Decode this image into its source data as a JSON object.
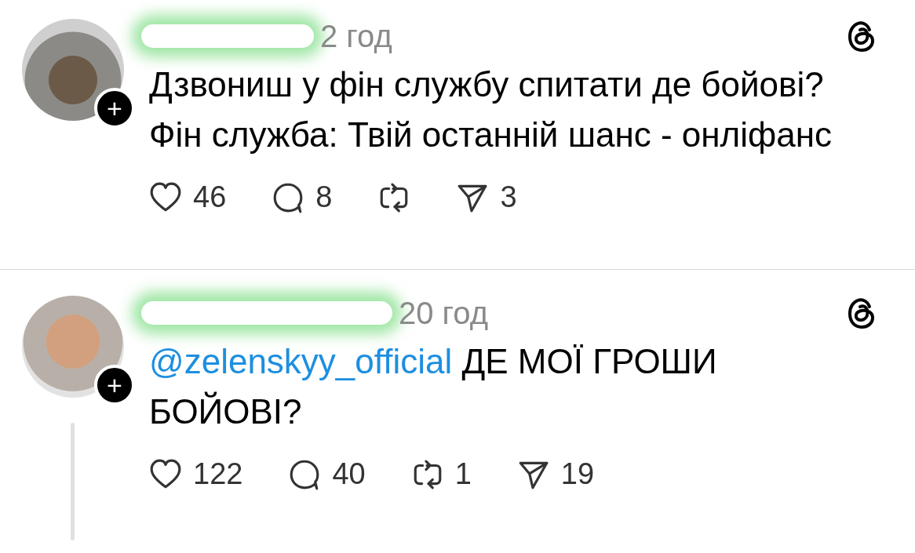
{
  "posts": [
    {
      "time": "2 год",
      "username_redacted": true,
      "follow_badge": "+",
      "thread_line": false,
      "lines": [
        [
          {
            "kind": "text",
            "text": "Дзвониш у фін службу спитати де бойові?"
          }
        ],
        [
          {
            "kind": "text",
            "text": "Фін служба: Твій останній шанс - онліфанс"
          }
        ]
      ],
      "actions": [
        {
          "kind": "like",
          "count": "46"
        },
        {
          "kind": "reply",
          "count": "8"
        },
        {
          "kind": "repost"
        },
        {
          "kind": "share",
          "count": "3"
        }
      ]
    },
    {
      "time": "20 год",
      "username_redacted": true,
      "follow_badge": "+",
      "thread_line": true,
      "lines": [
        [
          {
            "kind": "mention",
            "text": "@zelenskyy_official"
          },
          {
            "kind": "text",
            "text": " ДЕ МОЇ ГРОШИ"
          }
        ],
        [
          {
            "kind": "text",
            "text": "БОЙОВІ?"
          }
        ]
      ],
      "actions": [
        {
          "kind": "like",
          "count": "122"
        },
        {
          "kind": "reply",
          "count": "40"
        },
        {
          "kind": "repost",
          "count": "1"
        },
        {
          "kind": "share",
          "count": "19"
        }
      ]
    }
  ]
}
